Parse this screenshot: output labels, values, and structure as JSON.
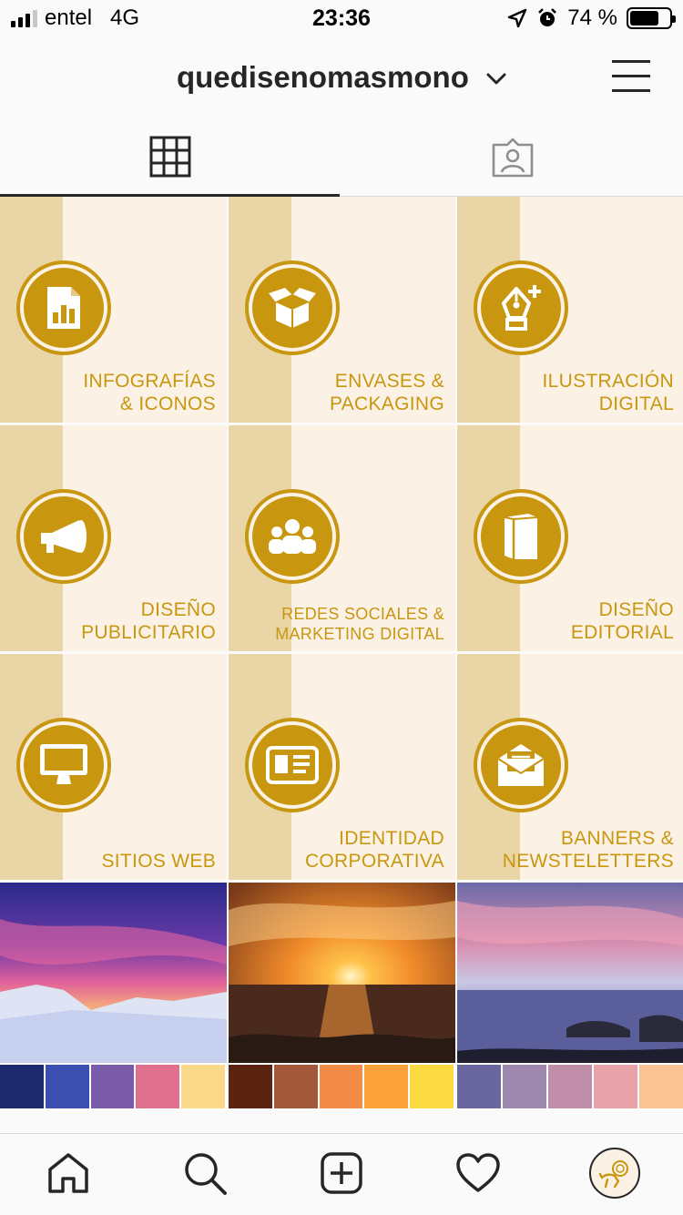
{
  "status": {
    "carrier": "entel",
    "network": "4G",
    "time": "23:36",
    "battery": "74 %",
    "battery_level": 0.74
  },
  "header": {
    "username": "quedisenomasmono"
  },
  "icons": {
    "menu": "hamburger-icon",
    "grid": "grid-icon",
    "tagged": "tagged-person-icon",
    "home": "home-icon",
    "search": "search-icon",
    "add": "add-post-icon",
    "activity": "heart-icon",
    "profile": "profile-avatar"
  },
  "colors": {
    "gold": "#c8960f",
    "cream": "#fbf2e5",
    "stripe": "#e9d5a5"
  },
  "tiles": [
    {
      "icon": "infographic-icon",
      "line1": "INFOGRAFÍAS",
      "line2": "& ICONOS"
    },
    {
      "icon": "box-icon",
      "line1": "ENVASES &",
      "line2": "PACKAGING"
    },
    {
      "icon": "pen-nib-icon",
      "line1": "ILUSTRACIÓN",
      "line2": "DIGITAL"
    },
    {
      "icon": "megaphone-icon",
      "line1": "DISEÑO",
      "line2": "PUBLICITARIO"
    },
    {
      "icon": "people-icon",
      "line1": "REDES SOCIALES &",
      "line2": "MARKETING DIGITAL"
    },
    {
      "icon": "book-icon",
      "line1": "DISEÑO",
      "line2": "EDITORIAL"
    },
    {
      "icon": "monitor-icon",
      "line1": "",
      "line2": "SITIOS WEB"
    },
    {
      "icon": "id-card-icon",
      "line1": "IDENTIDAD",
      "line2": "CORPORATIVA"
    },
    {
      "icon": "envelope-icon",
      "line1": "BANNERS &",
      "line2": "NEWSTELETTERS"
    }
  ],
  "photos": [
    {
      "name": "mountain-sunset",
      "palette": [
        "#1f2a6e",
        "#3a4fb0",
        "#7a5ba8",
        "#e0708e",
        "#fbd98a"
      ]
    },
    {
      "name": "ocean-sunset",
      "palette": [
        "#5a2410",
        "#a3583a",
        "#f28b45",
        "#fba33a",
        "#fcd940"
      ]
    },
    {
      "name": "pink-sky-sea",
      "palette": [
        "#6a66a0",
        "#9e88b0",
        "#c08ea8",
        "#e8a3aa",
        "#fbc393"
      ]
    }
  ]
}
